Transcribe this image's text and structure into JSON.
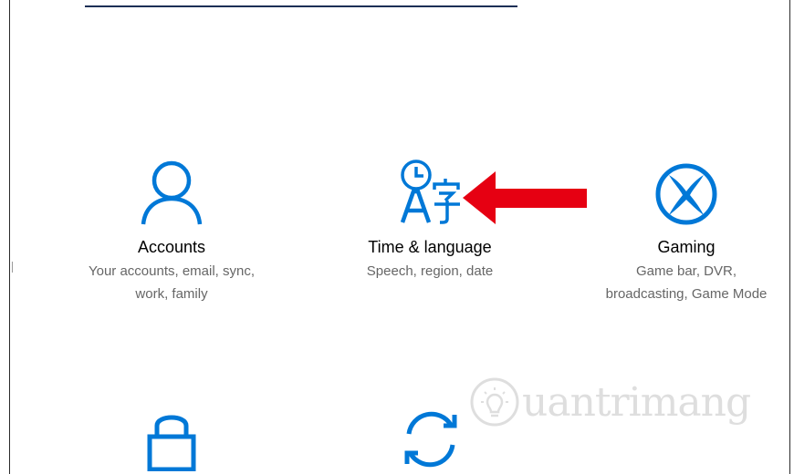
{
  "tiles": [
    {
      "title": "Accounts",
      "desc_line1": "Your accounts, email, sync,",
      "desc_line2": "work, family"
    },
    {
      "title": "Time & language",
      "desc_line1": "Speech, region, date"
    },
    {
      "title": "Gaming",
      "desc_line1": "Game bar, DVR,",
      "desc_line2": "broadcasting, Game Mode"
    }
  ],
  "watermark": {
    "text": "uantrimang"
  },
  "colors": {
    "accent": "#0078d7",
    "arrow": "#e60012",
    "title": "#000000",
    "desc": "#666666"
  },
  "icons": [
    "person-icon",
    "time-language-icon",
    "xbox-icon",
    "lock-icon",
    "sync-icon",
    "red-arrow-icon",
    "lightbulb-icon"
  ]
}
